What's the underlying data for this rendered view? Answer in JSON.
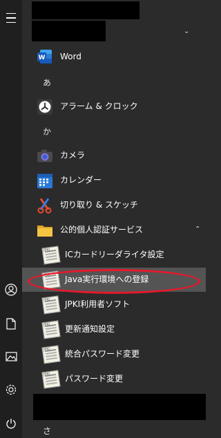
{
  "rail": {
    "items": [
      {
        "name": "menu-icon"
      },
      {
        "name": "user-icon"
      },
      {
        "name": "document-icon"
      },
      {
        "name": "pictures-icon"
      },
      {
        "name": "settings-icon"
      },
      {
        "name": "power-icon"
      }
    ]
  },
  "apps": {
    "word": "Word",
    "letter_a": "あ",
    "alarm": "アラーム & クロック",
    "letter_ka": "か",
    "camera": "カメラ",
    "calendar": "カレンダー",
    "snip": "切り取り & スケッチ",
    "jpki_folder": "公的個人認証サービス",
    "jpki_items": [
      "ICカードリーダライタ設定",
      "Java実行環境への登録",
      "JPKI利用者ソフト",
      "更新通知設定",
      "統合パスワード変更",
      "パスワード変更"
    ],
    "letter_sa": "さ"
  },
  "colors": {
    "background": "#2b2b2b",
    "rail": "#1f1f1f",
    "highlight": "#545454",
    "annotation": "#e8182b",
    "word_blue": "#185abd",
    "folder_yellow": "#f4c542",
    "calendar_blue": "#2a78d4"
  }
}
